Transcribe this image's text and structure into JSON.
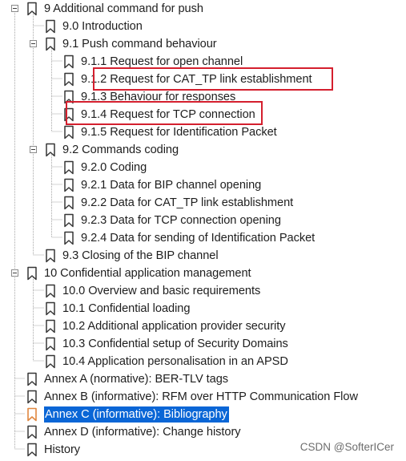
{
  "outline": {
    "items": [
      {
        "label": "9 Additional command for push"
      },
      {
        "label": "9.0 Introduction"
      },
      {
        "label": "9.1 Push command behaviour"
      },
      {
        "label": "9.1.1 Request for open channel"
      },
      {
        "label": "9.1.2 Request for CAT_TP link establishment"
      },
      {
        "label": "9.1.3 Behaviour for responses"
      },
      {
        "label": "9.1.4 Request for TCP connection"
      },
      {
        "label": "9.1.5 Request for Identification Packet"
      },
      {
        "label": "9.2 Commands coding"
      },
      {
        "label": "9.2.0 Coding"
      },
      {
        "label": "9.2.1 Data for BIP channel opening"
      },
      {
        "label": "9.2.2 Data for CAT_TP link establishment"
      },
      {
        "label": "9.2.3 Data for TCP connection opening"
      },
      {
        "label": "9.2.4 Data for sending of Identification Packet"
      },
      {
        "label": "9.3 Closing of the BIP channel"
      },
      {
        "label": "10 Confidential application management"
      },
      {
        "label": "10.0 Overview and basic requirements"
      },
      {
        "label": "10.1 Confidential loading"
      },
      {
        "label": "10.2 Additional application provider security"
      },
      {
        "label": "10.3 Confidential setup of Security Domains"
      },
      {
        "label": "10.4 Application personalisation in an APSD"
      },
      {
        "label": "Annex A (normative): BER-TLV tags"
      },
      {
        "label": "Annex B (informative): RFM over HTTP Communication Flow"
      },
      {
        "label": "Annex C (informative): Bibliography"
      },
      {
        "label": "Annex D (informative): Change history"
      },
      {
        "label": "History"
      }
    ],
    "selected_label": "Annex C (informative): Bibliography",
    "annotated_items": [
      "9.1.2 Request for CAT_TP link establishment",
      "9.1.4 Request for TCP connection"
    ]
  },
  "watermark": "CSDN @SofterICer",
  "colors": {
    "selection_background": "#0a66d6",
    "selection_text": "#ffffff",
    "annotation_red": "#d41f2e",
    "bookmark_normal": "#363636",
    "bookmark_selected": "#e0873f",
    "tree_line": "#a7a7a7"
  }
}
